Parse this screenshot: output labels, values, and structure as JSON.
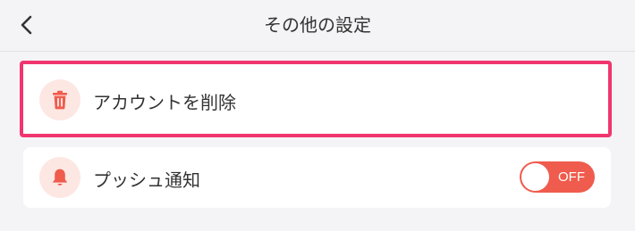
{
  "header": {
    "title": "その他の設定",
    "back_icon": "chevron-left-icon"
  },
  "settings": {
    "delete_account": {
      "label": "アカウントを削除",
      "icon": "trash-icon",
      "highlight_color": "#f0356f"
    },
    "push_notification": {
      "label": "プッシュ通知",
      "icon": "bell-icon",
      "toggle_text": "OFF",
      "toggle_state": "off"
    }
  },
  "colors": {
    "accent": "#ef5c4d",
    "icon_background": "#fde7e3",
    "page_background": "#f4f4f6"
  }
}
